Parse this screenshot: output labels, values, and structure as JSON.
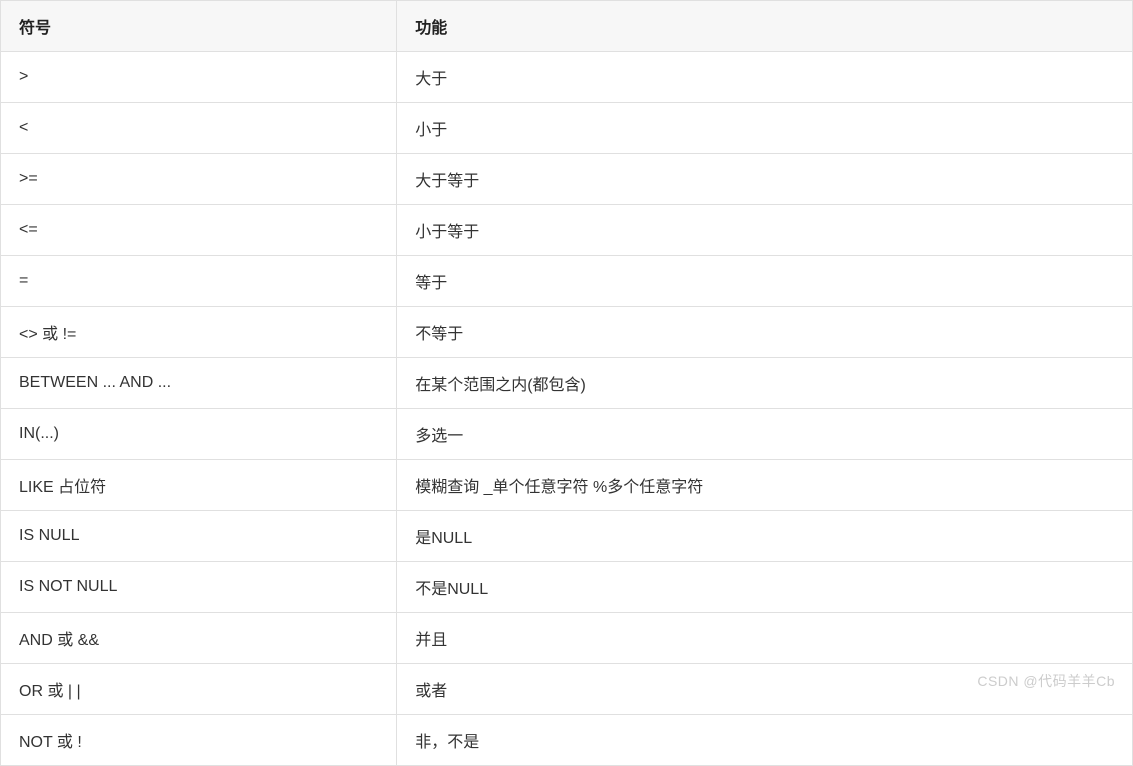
{
  "table": {
    "headers": {
      "symbol": "符号",
      "function": "功能"
    },
    "rows": [
      {
        "symbol": ">",
        "function": "大于"
      },
      {
        "symbol": "<",
        "function": "小于"
      },
      {
        "symbol": ">=",
        "function": "大于等于"
      },
      {
        "symbol": "<=",
        "function": "小于等于"
      },
      {
        "symbol": "=",
        "function": "等于"
      },
      {
        "symbol": "<> 或 !=",
        "function": "不等于"
      },
      {
        "symbol": "BETWEEN ... AND ...",
        "function": "在某个范围之内(都包含)"
      },
      {
        "symbol": "IN(...)",
        "function": "多选一"
      },
      {
        "symbol": "LIKE 占位符",
        "function": "模糊查询  _单个任意字符  %多个任意字符"
      },
      {
        "symbol": "IS NULL",
        "function": "是NULL"
      },
      {
        "symbol": "IS NOT NULL",
        "function": "不是NULL"
      },
      {
        "symbol": "AND 或 &&",
        "function": "并且"
      },
      {
        "symbol": "OR 或 | |",
        "function": "或者"
      },
      {
        "symbol": "NOT 或 !",
        "function": "非，不是"
      }
    ]
  },
  "watermark": "CSDN @代码羊羊Cb"
}
